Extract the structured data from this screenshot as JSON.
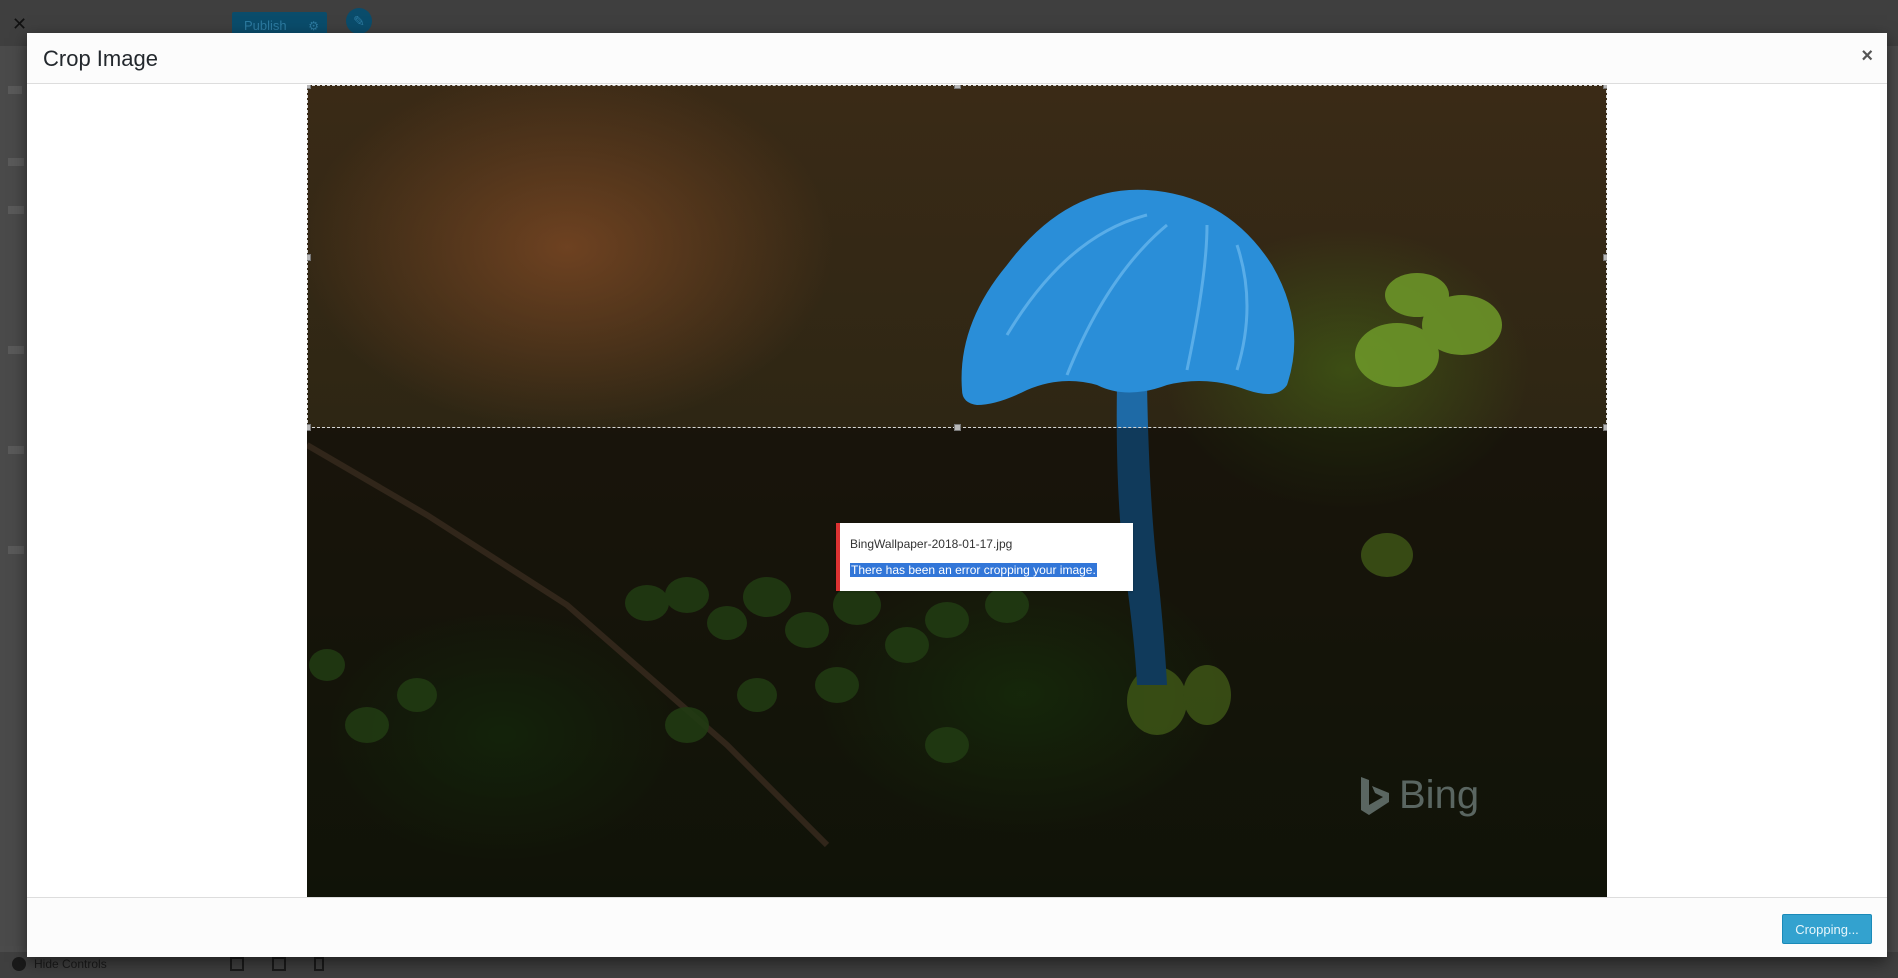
{
  "background": {
    "close_glyph": "✕",
    "publish_label": "Publish",
    "gear_icon": "gear-icon",
    "gear_glyph": "⚙",
    "pencil_icon": "pencil-icon",
    "pencil_glyph": "✎",
    "hide_controls_label": "Hide Controls"
  },
  "modal": {
    "title": "Crop Image",
    "close_glyph": "×",
    "footer": {
      "crop_button_label": "Cropping..."
    }
  },
  "image": {
    "watermark": "Bing"
  },
  "notice": {
    "filename": "BingWallpaper-2018-01-17.jpg",
    "message": "There has been an error cropping your image."
  },
  "colors": {
    "accent": "#33a2cf",
    "error": "#dc3232",
    "selection": "#3276d8"
  }
}
